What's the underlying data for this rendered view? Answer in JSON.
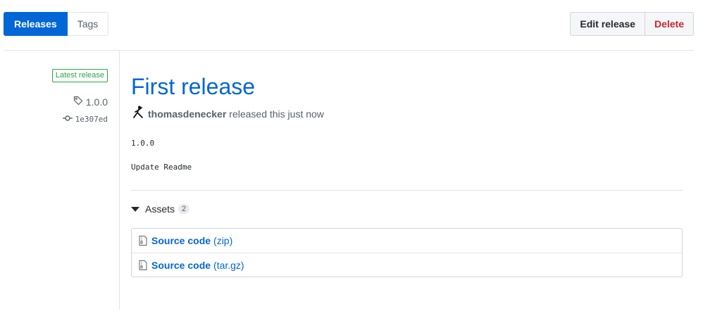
{
  "tabs": [
    {
      "label": "Releases",
      "active": true
    },
    {
      "label": "Tags",
      "active": false
    }
  ],
  "actions": {
    "edit_label": "Edit release",
    "delete_label": "Delete"
  },
  "sidebar": {
    "badge": "Latest release",
    "tag": "1.0.0",
    "commit": "1e307ed"
  },
  "release": {
    "title": "First release",
    "author": "thomasdenecker",
    "meta": "released this just now",
    "body_lines": [
      "1.0.0",
      "Update Readme"
    ]
  },
  "assets": {
    "label": "Assets",
    "count": "2",
    "items": [
      {
        "name": "Source code",
        "ext": "(zip)"
      },
      {
        "name": "Source code",
        "ext": "(tar.gz)"
      }
    ]
  },
  "colors": {
    "accent": "#0366d6",
    "danger": "#cb2431",
    "success": "#28a745"
  }
}
